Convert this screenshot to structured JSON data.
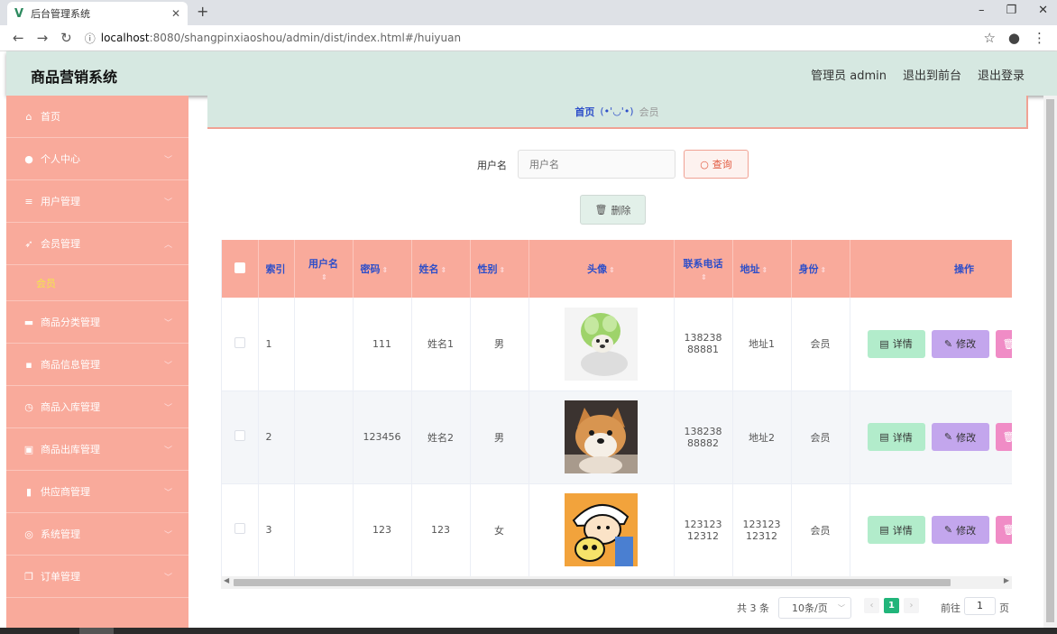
{
  "browser": {
    "tab_title": "后台管理系统",
    "tab_logo": "V",
    "url_host": "localhost",
    "url_path": ":8080/shangpinxiaoshou/admin/dist/index.html#/huiyuan",
    "close_glyph": "✕",
    "newtab_glyph": "+"
  },
  "header": {
    "title": "商品营销系统",
    "admin_label": "管理员 admin",
    "to_front": "退出到前台",
    "logout": "退出登录"
  },
  "sidebar": {
    "items": [
      {
        "label": "首页",
        "icon": "home-icon",
        "glyph": "⌂",
        "has_chevron": false
      },
      {
        "label": "个人中心",
        "icon": "user-icon",
        "glyph": "●",
        "has_chevron": true
      },
      {
        "label": "用户管理",
        "icon": "list-icon",
        "glyph": "≡",
        "has_chevron": true
      },
      {
        "label": "会员管理",
        "icon": "send-icon",
        "glyph": "➶",
        "has_chevron": true,
        "expanded": true
      },
      {
        "label": "商品分类管理",
        "icon": "monitor-icon",
        "glyph": "▬",
        "has_chevron": true
      },
      {
        "label": "商品信息管理",
        "icon": "message-icon",
        "glyph": "▪",
        "has_chevron": true
      },
      {
        "label": "商品入库管理",
        "icon": "clock-icon",
        "glyph": "◷",
        "has_chevron": true
      },
      {
        "label": "商品出库管理",
        "icon": "box-icon",
        "glyph": "▣",
        "has_chevron": true
      },
      {
        "label": "供应商管理",
        "icon": "bar-chart-icon",
        "glyph": "▮",
        "has_chevron": true
      },
      {
        "label": "系统管理",
        "icon": "settings-icon",
        "glyph": "◎",
        "has_chevron": true
      },
      {
        "label": "订单管理",
        "icon": "copy-icon",
        "glyph": "❐",
        "has_chevron": true
      }
    ],
    "submenu_label": "会员"
  },
  "breadcrumb": {
    "home": "首页",
    "face": "(•'◡'•)",
    "current": "会员"
  },
  "search": {
    "label": "用户名",
    "placeholder": "用户名",
    "button": "查询",
    "delete_button": "删除"
  },
  "table": {
    "columns": [
      "",
      "索引",
      "用户名",
      "密码",
      "姓名",
      "性别",
      "头像",
      "联系电话",
      "地址",
      "身份",
      "操作"
    ],
    "rows": [
      {
        "index": "1",
        "username": "",
        "password": "111",
        "name": "姓名1",
        "gender": "男",
        "avatar": "cabbage-dog",
        "phone": "13823888881",
        "address": "地址1",
        "role": "会员"
      },
      {
        "index": "2",
        "username": "",
        "password": "123456",
        "name": "姓名2",
        "gender": "男",
        "avatar": "shiba-dog",
        "phone": "13823888882",
        "address": "地址2",
        "role": "会员"
      },
      {
        "index": "3",
        "username": "",
        "password": "123",
        "name": "123",
        "gender": "女",
        "avatar": "cartoon-boy",
        "phone": "12312312312",
        "address": "12312312312",
        "role": "会员"
      }
    ],
    "actions": {
      "detail": "详情",
      "edit": "修改"
    }
  },
  "pagination": {
    "total": "共 3 条",
    "page_size": "10条/页",
    "current_page": "1",
    "goto_label": "前往",
    "goto_value": "1",
    "page_unit": "页"
  },
  "colors": {
    "sidebar": "#f9aa9b",
    "header": "#d6e8e1",
    "accent_blue": "#2d4ec9",
    "pager_active": "#21b57a"
  }
}
